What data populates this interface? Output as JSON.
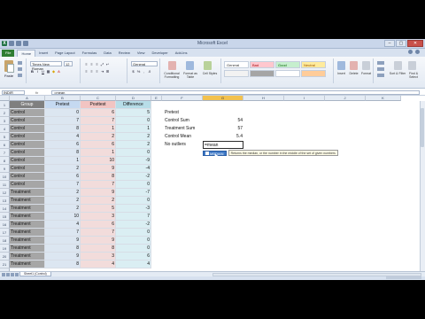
{
  "window": {
    "title": "Microsoft Excel",
    "controls": [
      "–",
      "▢",
      "✕"
    ]
  },
  "ribbon": {
    "tabs": [
      "File",
      "Home",
      "Insert",
      "Page Layout",
      "Formulas",
      "Data",
      "Review",
      "View",
      "Developer",
      "Add-Ins"
    ],
    "active_tab": "Home",
    "paste_label": "Paste",
    "font_name": "Times New Roman",
    "font_size": "12",
    "style_cells": [
      "General",
      "Bad",
      "Good",
      "Neutral"
    ],
    "groups": [
      "Clipboard",
      "Font",
      "Alignment",
      "Number",
      "Styles",
      "Cells",
      "Editing"
    ],
    "big_buttons": [
      "Conditional Formatting",
      "Format as Table",
      "Cell Styles",
      "Insert",
      "Delete",
      "Format",
      "Sort & Filter",
      "Find & Select"
    ]
  },
  "formula_bar": {
    "name_box": "INDIR",
    "fx": "fx",
    "formula": "=mean"
  },
  "grid": {
    "columns": [
      "A",
      "B",
      "C",
      "D",
      "E",
      "F",
      "G",
      "H",
      "I",
      "J",
      "K"
    ],
    "selected_column": "G",
    "rows": [
      "1",
      "2",
      "3",
      "4",
      "5",
      "6",
      "7",
      "8",
      "9",
      "10",
      "11",
      "12",
      "13",
      "14",
      "15",
      "16",
      "17",
      "18",
      "19",
      "20",
      "21",
      "22",
      "23",
      "24",
      "25",
      "26",
      "27",
      "28",
      "29",
      "30",
      "31",
      "32",
      "33",
      "34",
      "35",
      "36",
      "37",
      "38",
      "39",
      "40",
      "41",
      "42",
      "43"
    ]
  },
  "table": {
    "headers": [
      "Group",
      "Pretest",
      "Posttest",
      "Difference"
    ],
    "rows": [
      [
        "Control",
        "0",
        "6",
        "5"
      ],
      [
        "Control",
        "7",
        "7",
        "0"
      ],
      [
        "Control",
        "8",
        "1",
        "1"
      ],
      [
        "Control",
        "4",
        "2",
        "2"
      ],
      [
        "Control",
        "6",
        "6",
        "2"
      ],
      [
        "Control",
        "8",
        "1",
        "0"
      ],
      [
        "Control",
        "1",
        "10",
        "-9"
      ],
      [
        "Control",
        "2",
        "9",
        "-4"
      ],
      [
        "Control",
        "6",
        "8",
        "-2"
      ],
      [
        "Control",
        "7",
        "7",
        "0"
      ],
      [
        "Treatment",
        "2",
        "9",
        "-7"
      ],
      [
        "Treatment",
        "2",
        "2",
        "0"
      ],
      [
        "Treatment",
        "2",
        "5",
        "-3"
      ],
      [
        "Treatment",
        "10",
        "3",
        "7"
      ],
      [
        "Treatment",
        "4",
        "6",
        "-2"
      ],
      [
        "Treatment",
        "7",
        "7",
        "0"
      ],
      [
        "Treatment",
        "9",
        "9",
        "0"
      ],
      [
        "Treatment",
        "8",
        "8",
        "0"
      ],
      [
        "Treatment",
        "9",
        "3",
        "6"
      ],
      [
        "Treatment",
        "8",
        "4",
        "4"
      ]
    ]
  },
  "summary": {
    "labels": [
      "Pretest",
      "Control Sum",
      "Treatment Sum",
      "Control Mean",
      "No outliers"
    ],
    "values": [
      "",
      "54",
      "57",
      "5.4",
      ""
    ],
    "editing_value": "=mean",
    "autocomplete_item": "MEDIAN",
    "autocomplete_tip": "Returns the median, or the number in the middle of the set of given numbers"
  },
  "sheets": {
    "tabs": [
      "Sheet1 (Control)"
    ]
  }
}
